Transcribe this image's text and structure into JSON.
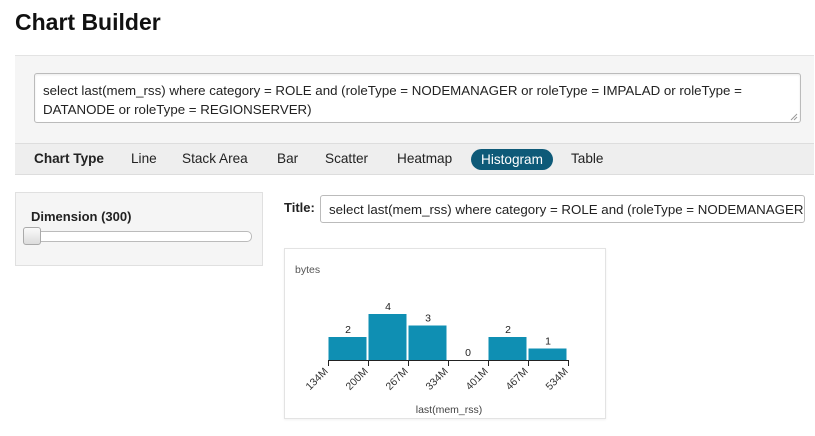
{
  "page": {
    "title": "Chart Builder"
  },
  "query": {
    "text": "select last(mem_rss) where category = ROLE and (roleType = NODEMANAGER or roleType = IMPALAD or roleType = DATANODE or roleType = REGIONSERVER)"
  },
  "chart_types": {
    "label": "Chart Type",
    "items": [
      "Line",
      "Stack Area",
      "Bar",
      "Scatter",
      "Heatmap",
      "Histogram",
      "Table"
    ],
    "active": "Histogram"
  },
  "dimension": {
    "label": "Dimension (300)",
    "slider_value": 0
  },
  "title_field": {
    "label": "Title:",
    "value": "select last(mem_rss) where category = ROLE and (roleType = NODEMANAGER or roleType = IMPALAD or roleType = DATANODE or roleType = REGIONSERVER)"
  },
  "chart_data": {
    "type": "bar",
    "subtype": "histogram",
    "ylabel": "bytes",
    "xlabel": "last(mem_rss)",
    "bin_edges": [
      "134M",
      "200M",
      "267M",
      "334M",
      "401M",
      "467M",
      "534M"
    ],
    "counts": [
      2,
      4,
      3,
      0,
      2,
      1
    ],
    "ylim": [
      0,
      4
    ],
    "color": "#0f8fb3",
    "grid": false
  },
  "colors": {
    "accent": "#0e5a78",
    "bar": "#0f8fb3"
  }
}
